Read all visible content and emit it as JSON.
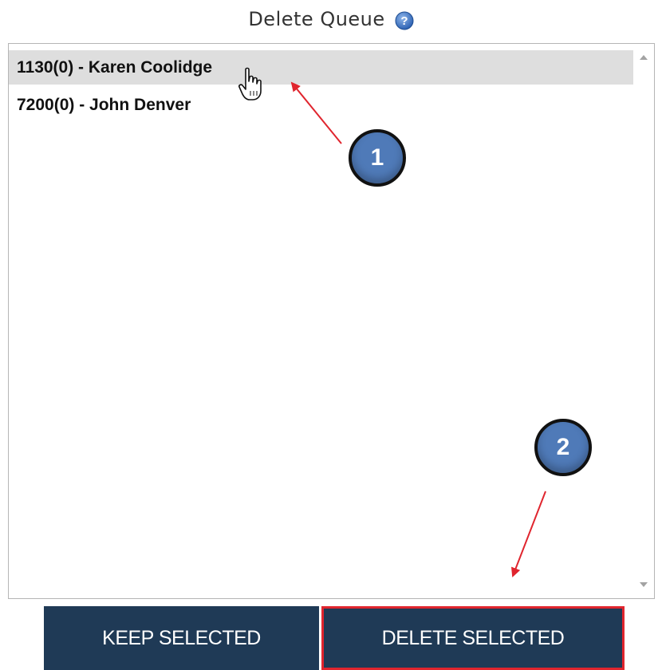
{
  "dialog": {
    "title": "Delete Queue",
    "help_icon": "help-icon"
  },
  "queue_list": {
    "items": [
      {
        "label": "1130(0) - Karen Coolidge",
        "selected": true
      },
      {
        "label": "7200(0) - John Denver",
        "selected": false
      }
    ]
  },
  "buttons": {
    "keep_label": "KEEP SELECTED",
    "delete_label": "DELETE SELECTED"
  },
  "annotations": {
    "step_1": "1",
    "step_2": "2"
  },
  "colors": {
    "button_bg": "#1f3a56",
    "button_text": "#ffffff",
    "selection_bg": "#dedede",
    "highlight_border": "#e0252e",
    "arrow": "#e0252e",
    "badge_fill": "#4f7ab8"
  }
}
